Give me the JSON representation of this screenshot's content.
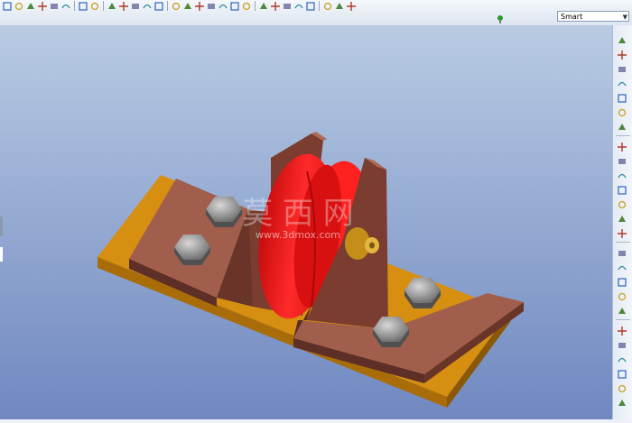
{
  "toolbar": {
    "top_icons": [
      "new-file-icon",
      "open-folder-icon",
      "save-icon",
      "print-icon",
      "email-icon",
      "close-window-icon",
      "undo-icon",
      "redo-icon",
      "cut-icon",
      "copy-icon",
      "paste-icon",
      "paste-special-icon",
      "regenerate-icon",
      "find-icon",
      "select-box-icon",
      "refit-icon",
      "zoom-in-icon",
      "zoom-out-icon",
      "repaint-icon",
      "view-orient-icon",
      "saved-views-icon",
      "spin-center-icon",
      "datum-plane-icon",
      "datum-axis-icon",
      "datum-point-icon",
      "csys-icon",
      "annotation-icon",
      "help-icon"
    ],
    "filter_value": "Smart"
  },
  "right_toolbar": {
    "icons": [
      "sketch-icon",
      "plane-icon",
      "axis-icon",
      "curve-icon",
      "point-icon",
      "csys-icon",
      "analysis-icon",
      "extrude-icon",
      "revolve-icon",
      "sweep-icon",
      "hole-icon",
      "shell-icon",
      "rib-icon",
      "draft-icon",
      "round-icon",
      "chamfer-icon",
      "copy-feature-icon",
      "mirror-icon",
      "merge-icon",
      "trim-icon",
      "pattern-icon",
      "offset-icon",
      "thicken-icon",
      "solidify-icon",
      "more-icon"
    ]
  },
  "model": {
    "watermark_cn": "莫 西 网",
    "watermark_url": "www.3dmox.com",
    "colors": {
      "viewport_top": "#b9cbe3",
      "viewport_bottom": "#6f88c0",
      "base_plate": "#d68f10",
      "bracket": "#9a5a4a",
      "wheel": "#f01818",
      "bolt": "#9a9a9a",
      "grease_fitting": "#d4a020"
    }
  }
}
